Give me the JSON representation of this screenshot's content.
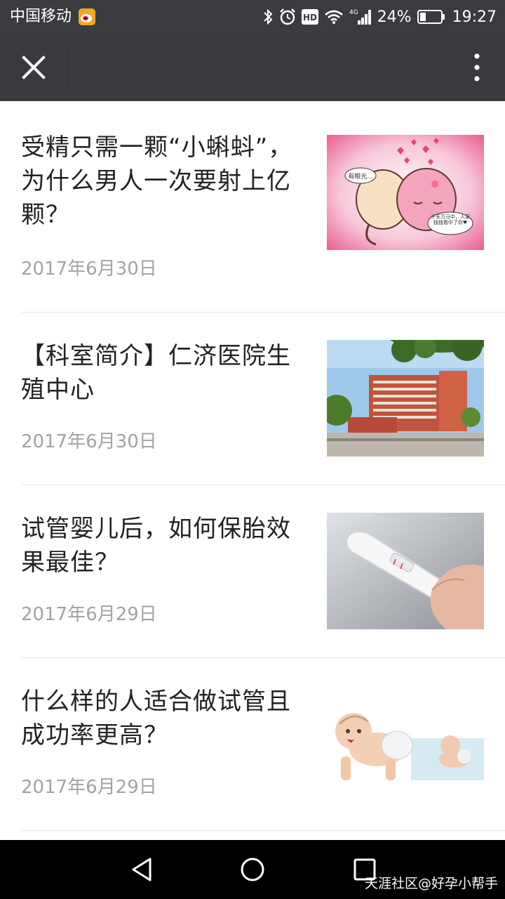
{
  "status_bar": {
    "carrier": "中国移动",
    "network": "4G",
    "battery": "24%",
    "time": "19:27",
    "icons": [
      "weibo-icon",
      "bluetooth-icon",
      "alarm-icon",
      "hd-icon",
      "wifi-icon",
      "signal-icon",
      "battery-icon"
    ]
  },
  "title_bar": {
    "close_icon": "close-icon",
    "more_icon": "more-vertical-icon"
  },
  "articles": [
    {
      "title": "受精只需一颗“小蝌蚪”，为什么男人一次要射上亿颗？",
      "date": "2017年6月30日",
      "thumb_labels": [
        "有眼光...",
        "千军万马中，人家独独看中了你♥"
      ]
    },
    {
      "title": "【科室简介】仁济医院生殖中心",
      "date": "2017年6月30日"
    },
    {
      "title": "试管婴儿后，如何保胎效果最佳？",
      "date": "2017年6月29日"
    },
    {
      "title": "什么样的人适合做试管且成功率更高？",
      "date": "2017年6月29日"
    }
  ],
  "nav_bar": {
    "watermark": "天涯社区@好孕小帮手"
  },
  "colors": {
    "status_bar_bg": "#3a3b3f",
    "title_bar_bg": "#393a3f",
    "title_text": "#222222",
    "date_text": "#a3a3a3"
  }
}
